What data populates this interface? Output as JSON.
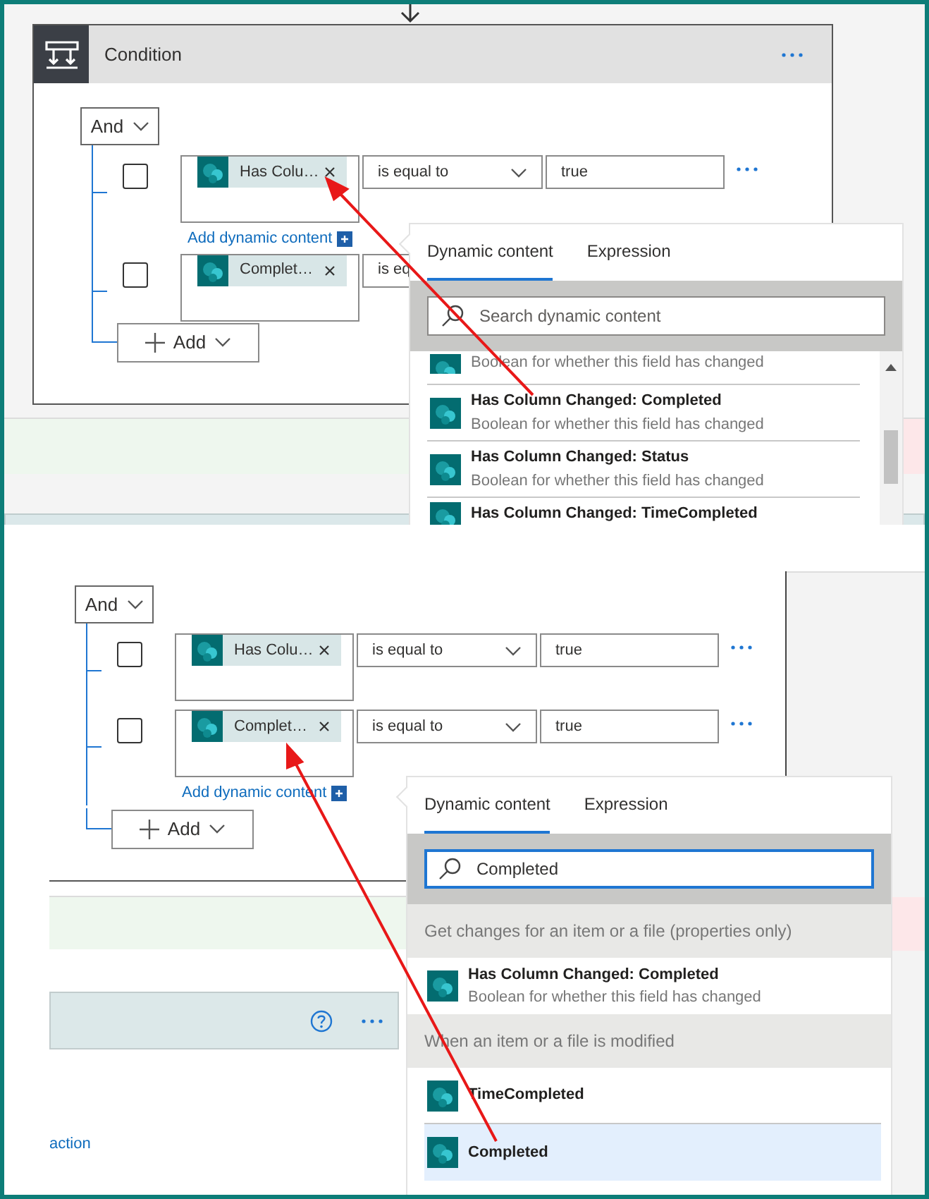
{
  "top_panel": {
    "condition": {
      "title": "Condition",
      "group_operator": "And",
      "add_button": "Add",
      "rows": [
        {
          "checked": false,
          "token": "Has Colu…",
          "operator": "is equal to",
          "value": "true",
          "add_dynamic_content": "Add dynamic content"
        },
        {
          "checked": false,
          "token": "Complet…",
          "operator": "is eq"
        }
      ]
    },
    "popup": {
      "tabs": [
        {
          "label": "Dynamic content",
          "selected": true
        },
        {
          "label": "Expression",
          "selected": false
        }
      ],
      "search": {
        "placeholder": "Search dynamic content"
      },
      "items": [
        {
          "description": "Boolean for whether this field has changed"
        },
        {
          "title": "Has Column Changed: Completed",
          "description": "Boolean for whether this field has changed"
        },
        {
          "title": "Has Column Changed: Status",
          "description": "Boolean for whether this field has changed"
        },
        {
          "title": "Has Column Changed: TimeCompleted"
        }
      ]
    }
  },
  "bottom_panel": {
    "condition": {
      "group_operator": "And",
      "add_button": "Add",
      "rows": [
        {
          "checked": false,
          "token": "Has Colu…",
          "operator": "is equal to",
          "value": "true"
        },
        {
          "checked": false,
          "token": "Complet…",
          "operator": "is equal to",
          "value": "true",
          "add_dynamic_content": "Add dynamic content"
        }
      ]
    },
    "popup": {
      "tabs": [
        {
          "label": "Dynamic content",
          "selected": true
        },
        {
          "label": "Expression",
          "selected": false
        }
      ],
      "search": {
        "value": "Completed"
      },
      "groups": [
        {
          "heading": "Get changes for an item or a file (properties only)",
          "items": [
            {
              "title": "Has Column Changed: Completed",
              "description": "Boolean for whether this field has changed",
              "selected": false
            }
          ]
        },
        {
          "heading": "When an item or a file is modified",
          "items": [
            {
              "title": "TimeCompleted",
              "selected": false
            },
            {
              "title": "Completed",
              "selected": true
            }
          ]
        }
      ]
    },
    "action_link": "action"
  }
}
